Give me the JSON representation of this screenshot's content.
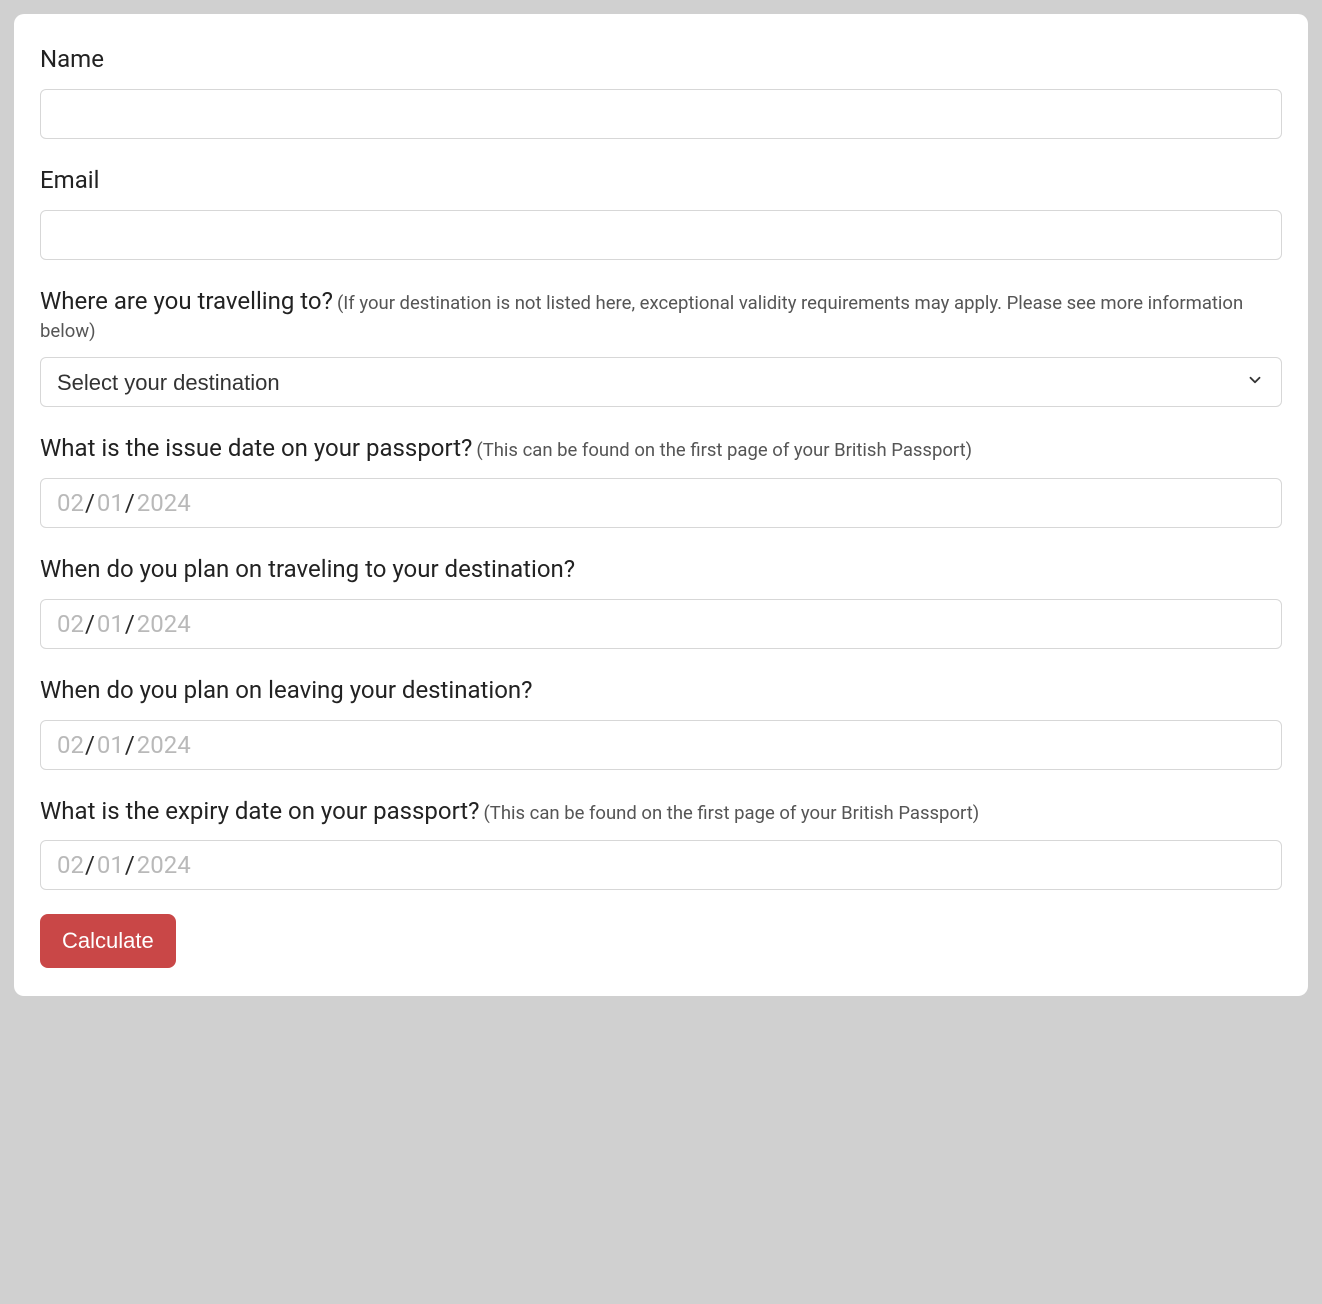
{
  "form": {
    "name": {
      "label": "Name",
      "value": ""
    },
    "email": {
      "label": "Email",
      "value": ""
    },
    "destination": {
      "label": "Where are you travelling to?",
      "hint": "(If your destination is not listed here, exceptional validity requirements may apply. Please see more information below)",
      "placeholder": "Select your destination",
      "value": ""
    },
    "issue_date": {
      "label": "What is the issue date on your passport?",
      "hint": "(This can be found on the first page of your British Passport)",
      "day": "02",
      "month": "01",
      "year": "2024"
    },
    "travel_date": {
      "label": "When do you plan on traveling to your destination?",
      "day": "02",
      "month": "01",
      "year": "2024"
    },
    "leave_date": {
      "label": "When do you plan on leaving your destination?",
      "day": "02",
      "month": "01",
      "year": "2024"
    },
    "expiry_date": {
      "label": "What is the expiry date on your passport?",
      "hint": "(This can be found on the first page of your British Passport)",
      "day": "02",
      "month": "01",
      "year": "2024"
    },
    "submit_label": "Calculate"
  }
}
